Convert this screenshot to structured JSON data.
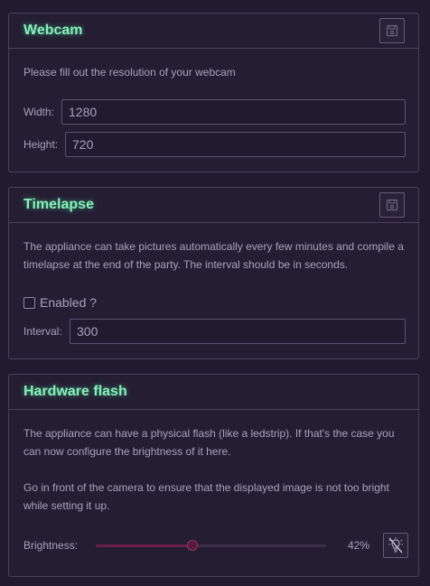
{
  "webcam": {
    "title": "Webcam",
    "description": "Please fill out the resolution of your webcam",
    "width_label": "Width:",
    "width_value": "1280",
    "height_label": "Height:",
    "height_value": "720",
    "save_icon": "save-icon"
  },
  "timelapse": {
    "title": "Timelapse",
    "description": "The appliance can take pictures automatically every few minutes and compile a timelapse at the end of the party. The interval should be in seconds.",
    "enabled_label": "Enabled ?",
    "enabled": false,
    "interval_label": "Interval:",
    "interval_value": "300",
    "save_icon": "save-icon"
  },
  "hardware_flash": {
    "title": "Hardware flash",
    "description1": "The appliance can have a physical flash (like a ledstrip). If that's the case you can now configure the brightness of it here.",
    "description2": "Go in front of the camera to ensure that the displayed image is not too bright while setting it up.",
    "brightness_label": "Brightness:",
    "brightness_fraction": 0.42,
    "brightness_text": "42%",
    "flash_toggle_icon": "lightbulb-off-icon"
  },
  "colors": {
    "accent_title": "#86f0b9",
    "slider_fill": "#6b2045",
    "background": "#221b30"
  }
}
